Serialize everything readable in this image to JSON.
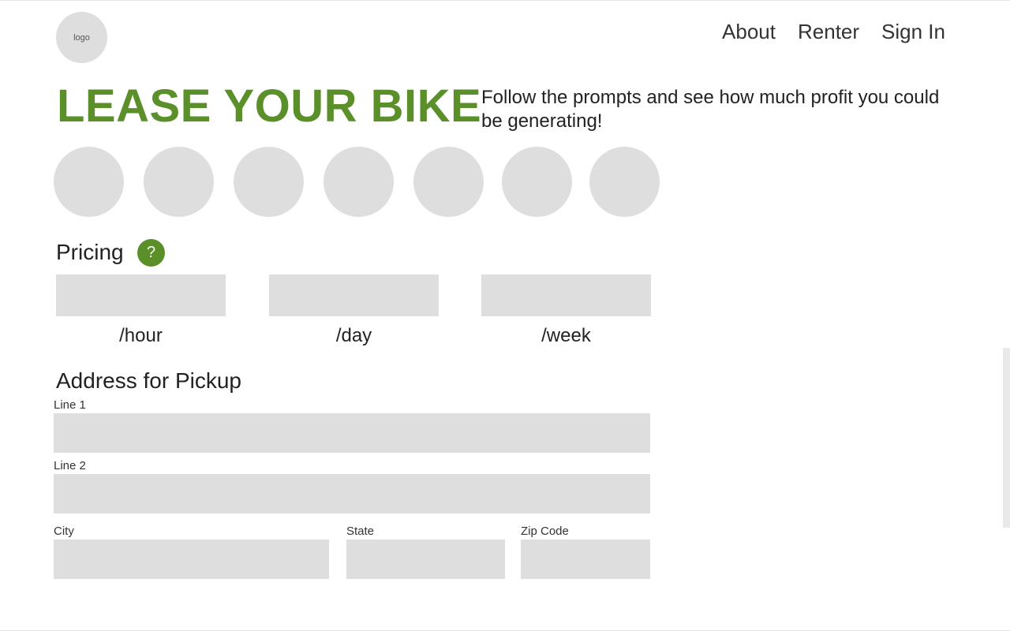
{
  "header": {
    "logo_text": "logo",
    "nav": [
      "About",
      "Renter",
      "Sign In"
    ]
  },
  "hero": {
    "title": "LEASE YOUR BIKE",
    "subtitle": "Follow the prompts and see how much profit you could be generating!"
  },
  "pricing": {
    "title": "Pricing",
    "help_icon": "?",
    "units": [
      "/hour",
      "/day",
      "/week"
    ]
  },
  "address": {
    "title": "Address for Pickup",
    "line1_label": "Line 1",
    "line2_label": "Line 2",
    "city_label": "City",
    "state_label": "State",
    "zip_label": "Zip Code"
  },
  "colors": {
    "accent": "#5a8f29",
    "placeholder_gray": "#dedede"
  }
}
